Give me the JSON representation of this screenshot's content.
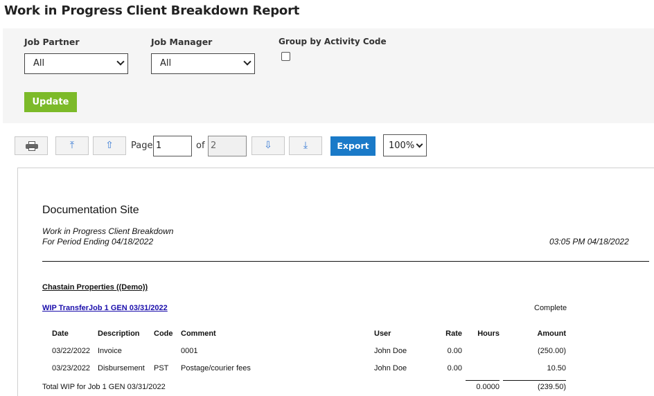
{
  "page_title": "Work in Progress Client Breakdown Report",
  "filters": {
    "job_partner_label": "Job Partner",
    "job_partner_value": "All",
    "job_manager_label": "Job Manager",
    "job_manager_value": "All",
    "group_by_label": "Group by Activity Code",
    "group_by_checked": false,
    "update_label": "Update"
  },
  "toolbar": {
    "page_label": "Page",
    "page_value": "1",
    "of_label": "of",
    "total_pages": "2",
    "export_label": "Export",
    "zoom_value": "100%",
    "icons": [
      "printer-icon",
      "first-page-icon",
      "previous-page-icon",
      "next-page-icon",
      "last-page-icon"
    ]
  },
  "report": {
    "site_name": "Documentation Site",
    "report_name": "Work in Progress Client Breakdown",
    "period": "For Period Ending 04/18/2022",
    "generated": "03:05 PM 04/18/2022",
    "client": "Chastain Properties ((Demo))",
    "job_link": "WIP TransferJob 1 GEN 03/31/2022",
    "job_status": "Complete",
    "columns": [
      "Date",
      "Description",
      "Code",
      "Comment",
      "User",
      "Rate",
      "Hours",
      "Amount"
    ],
    "rows": [
      {
        "date": "03/22/2022",
        "description": "Invoice",
        "code": "",
        "comment": "0001",
        "user": "John Doe",
        "rate": "0.00",
        "hours": "",
        "amount": "(250.00)"
      },
      {
        "date": "03/23/2022",
        "description": "Disbursement",
        "code": "PST",
        "comment": "Postage/courier fees",
        "user": "John Doe",
        "rate": "0.00",
        "hours": "",
        "amount": "10.50"
      }
    ],
    "total_label": "Total WIP for Job 1 GEN 03/31/2022",
    "total_hours": "0.0000",
    "total_amount": "(239.50)"
  }
}
